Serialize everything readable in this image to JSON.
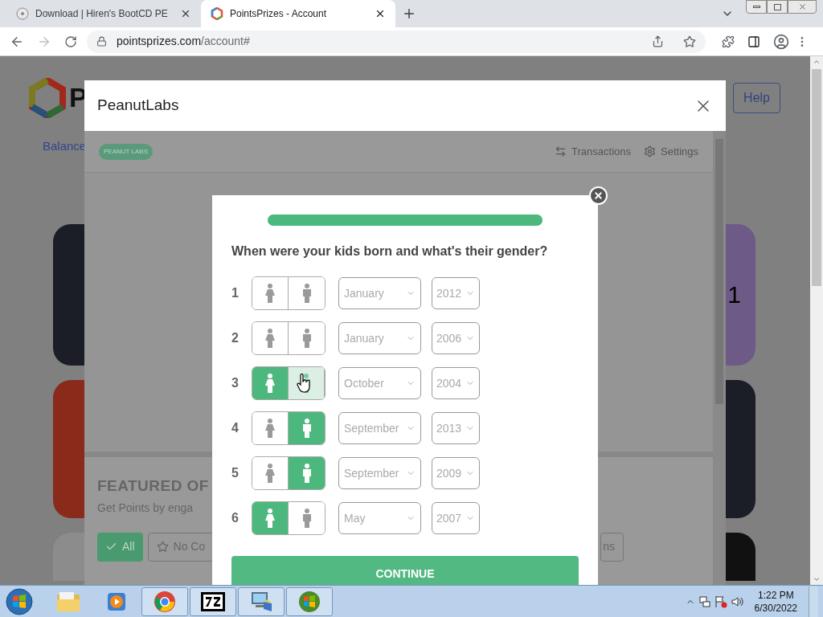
{
  "browser": {
    "tabs": [
      {
        "title": "Download | Hiren's BootCD PE",
        "selected": false
      },
      {
        "title": "PointsPrizes - Account",
        "selected": true
      }
    ],
    "url": {
      "host": "pointsprizes.com",
      "path": "/account#"
    }
  },
  "site": {
    "logo_letter": "P",
    "balance_link": "Balance",
    "help_button": "Help",
    "card_text": "1"
  },
  "peanut_dialog": {
    "title": "PeanutLabs",
    "badge": "PEANUT LABS",
    "nav": [
      {
        "kind": "transactions",
        "label": "Transactions"
      },
      {
        "kind": "settings",
        "label": "Settings"
      }
    ],
    "featured_heading": "FEATURED OF",
    "featured_subtitle": "Get Points by enga",
    "filters": [
      {
        "label": "All",
        "selected": true
      },
      {
        "label": "No Co",
        "selected": false
      },
      {
        "label": "ns",
        "selected": false
      }
    ]
  },
  "survey": {
    "progress": {
      "level": 1
    },
    "question": "When were your kids born and what's their gender?",
    "kids": [
      {
        "number": "1",
        "options": [
          {
            "kind": "girl",
            "selected": false,
            "hovered": false
          },
          {
            "kind": "boy",
            "selected": false,
            "hovered": false
          }
        ],
        "month": "January",
        "year": "2012"
      },
      {
        "number": "2",
        "options": [
          {
            "kind": "girl",
            "selected": false,
            "hovered": false
          },
          {
            "kind": "boy",
            "selected": false,
            "hovered": false
          }
        ],
        "month": "January",
        "year": "2006"
      },
      {
        "number": "3",
        "options": [
          {
            "kind": "girl",
            "selected": true,
            "hovered": false
          },
          {
            "kind": "boy",
            "selected": false,
            "hovered": true
          }
        ],
        "month": "October",
        "year": "2004"
      },
      {
        "number": "4",
        "options": [
          {
            "kind": "girl",
            "selected": false,
            "hovered": false
          },
          {
            "kind": "boy",
            "selected": true,
            "hovered": false
          }
        ],
        "month": "September",
        "year": "2013"
      },
      {
        "number": "5",
        "options": [
          {
            "kind": "girl",
            "selected": false,
            "hovered": false
          },
          {
            "kind": "boy",
            "selected": true,
            "hovered": false
          }
        ],
        "month": "September",
        "year": "2009"
      },
      {
        "number": "6",
        "options": [
          {
            "kind": "girl",
            "selected": true,
            "hovered": false
          },
          {
            "kind": "boy",
            "selected": false,
            "hovered": false
          }
        ],
        "month": "May",
        "year": "2007"
      }
    ],
    "continue": "CONTINUE"
  },
  "taskbar": {
    "apps": [
      {
        "kind": "explorer",
        "running": false
      },
      {
        "kind": "media",
        "running": false
      },
      {
        "kind": "chrome",
        "running": true
      },
      {
        "kind": "sevenzip",
        "running": true
      },
      {
        "kind": "computer",
        "running": true
      },
      {
        "kind": "windows",
        "running": true
      }
    ],
    "time": "1:22 PM",
    "date": "6/30/2022"
  }
}
